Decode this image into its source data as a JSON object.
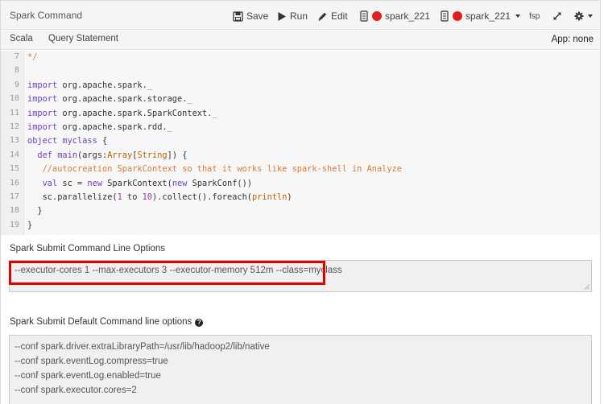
{
  "header": {
    "title": "Spark Command",
    "save_label": "Save",
    "run_label": "Run",
    "edit_label": "Edit",
    "cluster_1": "spark_221",
    "cluster_2": "spark_221",
    "fsp_label": "fsp"
  },
  "tabs": {
    "scala": "Scala",
    "query": "Query Statement",
    "app_status": "App: none"
  },
  "editor": {
    "lines": [
      {
        "n": "7",
        "parts": [
          {
            "t": "*/",
            "c": "cm"
          }
        ]
      },
      {
        "n": "8",
        "parts": []
      },
      {
        "n": "9",
        "parts": [
          {
            "t": "import",
            "c": "kw"
          },
          {
            "t": " org.apache.spark."
          },
          {
            "t": "_",
            "c": "ty"
          }
        ]
      },
      {
        "n": "10",
        "parts": [
          {
            "t": "import",
            "c": "kw"
          },
          {
            "t": " org.apache.spark.storage."
          },
          {
            "t": "_",
            "c": "ty"
          }
        ]
      },
      {
        "n": "11",
        "parts": [
          {
            "t": "import",
            "c": "kw"
          },
          {
            "t": " org.apache.spark.SparkContext."
          },
          {
            "t": "_",
            "c": "ty"
          }
        ]
      },
      {
        "n": "12",
        "parts": [
          {
            "t": "import",
            "c": "kw"
          },
          {
            "t": " org.apache.spark.rdd."
          },
          {
            "t": "_",
            "c": "ty"
          }
        ]
      },
      {
        "n": "13",
        "parts": [
          {
            "t": "object",
            "c": "kw"
          },
          {
            "t": " "
          },
          {
            "t": "myclass",
            "c": "kw"
          },
          {
            "t": " {"
          }
        ]
      },
      {
        "n": "14",
        "parts": [
          {
            "t": "  "
          },
          {
            "t": "def",
            "c": "kw"
          },
          {
            "t": " "
          },
          {
            "t": "main",
            "c": "kw"
          },
          {
            "t": "(args:"
          },
          {
            "t": "Array",
            "c": "ty"
          },
          {
            "t": "["
          },
          {
            "t": "String",
            "c": "ty"
          },
          {
            "t": "]) {"
          }
        ]
      },
      {
        "n": "15",
        "parts": [
          {
            "t": "   "
          },
          {
            "t": "//autocreation SparkContext so that it works like spark-shell in Analyze",
            "c": "cm"
          }
        ]
      },
      {
        "n": "16",
        "parts": [
          {
            "t": "   "
          },
          {
            "t": "val",
            "c": "kw"
          },
          {
            "t": " sc = "
          },
          {
            "t": "new",
            "c": "kw"
          },
          {
            "t": " SparkContext("
          },
          {
            "t": "new",
            "c": "kw"
          },
          {
            "t": " SparkConf())"
          }
        ]
      },
      {
        "n": "17",
        "parts": [
          {
            "t": "   sc.parallelize("
          },
          {
            "t": "1",
            "c": "nm"
          },
          {
            "t": " to "
          },
          {
            "t": "10",
            "c": "nm"
          },
          {
            "t": ").collect().foreach("
          },
          {
            "t": "println",
            "c": "ty"
          },
          {
            "t": ")"
          }
        ]
      },
      {
        "n": "18",
        "parts": [
          {
            "t": "  }"
          }
        ]
      },
      {
        "n": "19",
        "parts": [
          {
            "t": "}"
          }
        ]
      }
    ]
  },
  "options": {
    "submit_label": "Spark Submit Command Line Options",
    "submit_value": "--executor-cores 1 --max-executors 3 --executor-memory 512m --class=myclass",
    "default_label": "Spark Submit Default Command line options",
    "default_lines": [
      "--conf spark.driver.extraLibraryPath=/usr/lib/hadoop2/lib/native",
      "--conf spark.eventLog.compress=true",
      "--conf spark.eventLog.enabled=true",
      "--conf spark.executor.cores=2"
    ]
  },
  "colors": {
    "cluster_status": "#e02020",
    "highlight": "#e00000"
  }
}
